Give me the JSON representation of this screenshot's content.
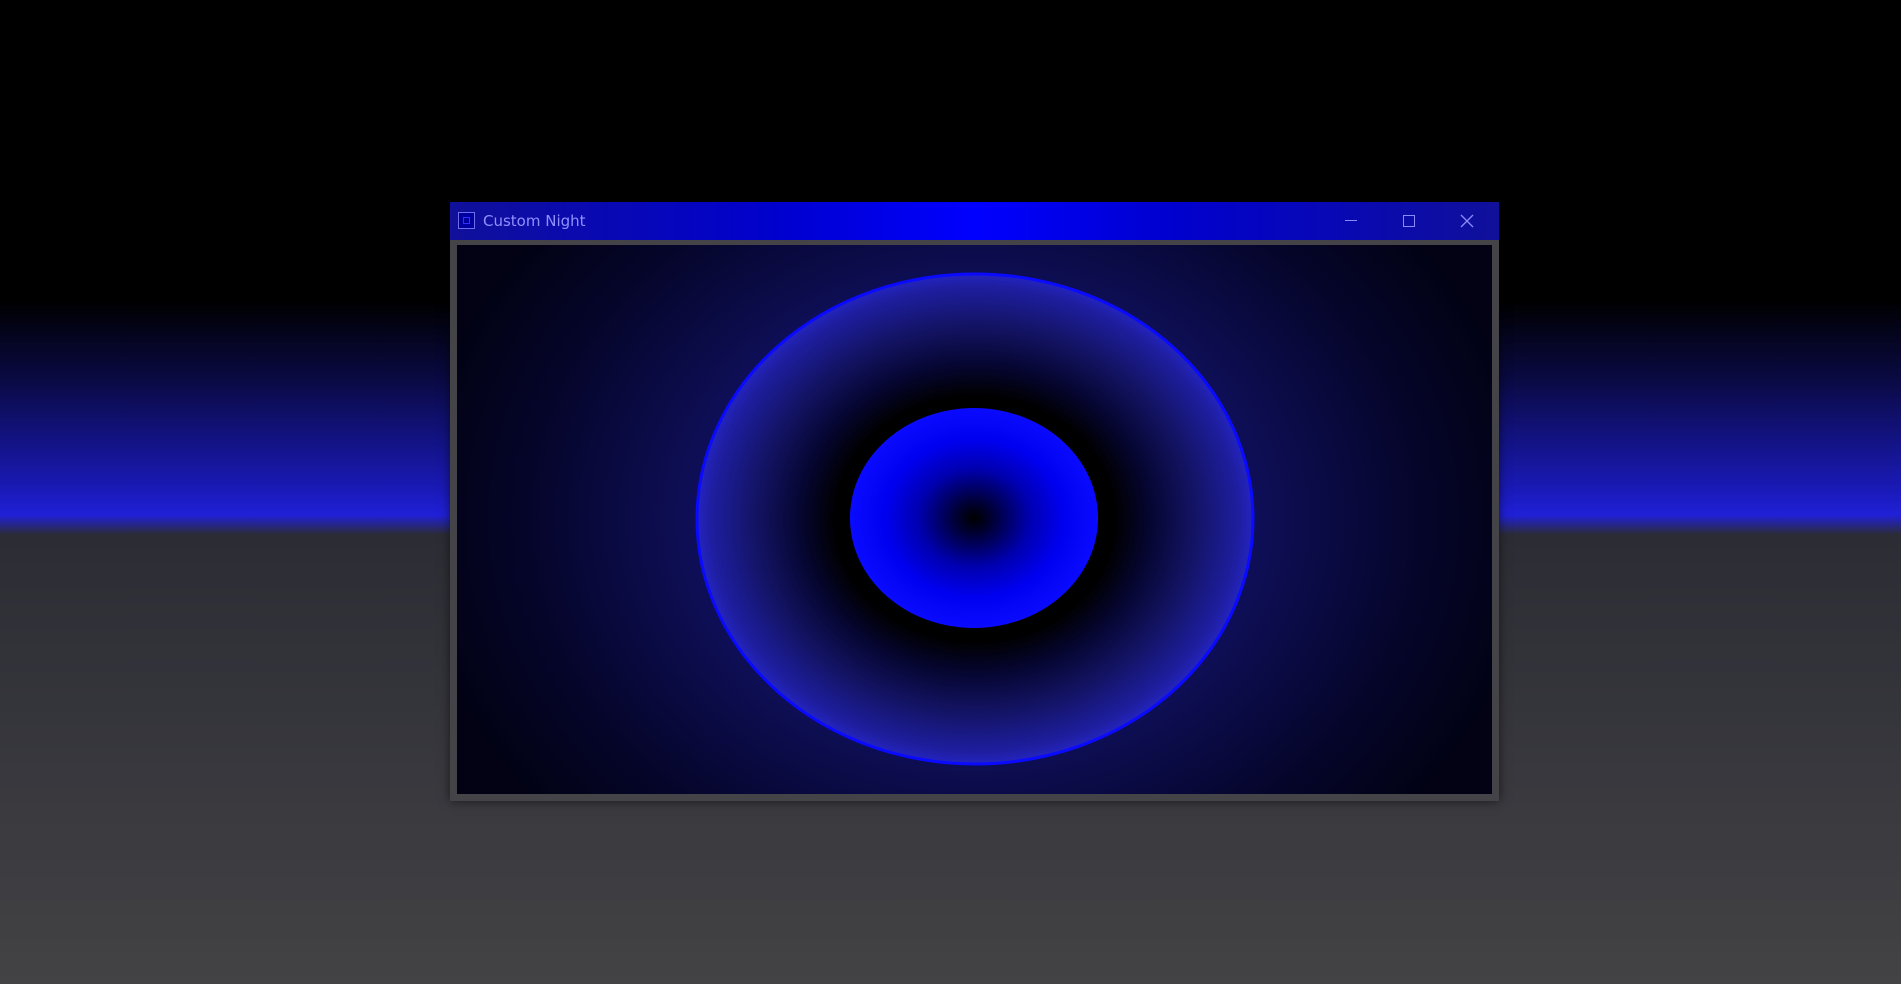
{
  "window": {
    "title": "Custom Night",
    "controls": {
      "minimize_icon": "minimize-icon",
      "maximize_icon": "maximize-icon",
      "close_icon": "close-icon"
    }
  },
  "colors": {
    "accent_blue": "#0000ff",
    "title_text": "#9090ff",
    "frame_gray": "#444448"
  }
}
